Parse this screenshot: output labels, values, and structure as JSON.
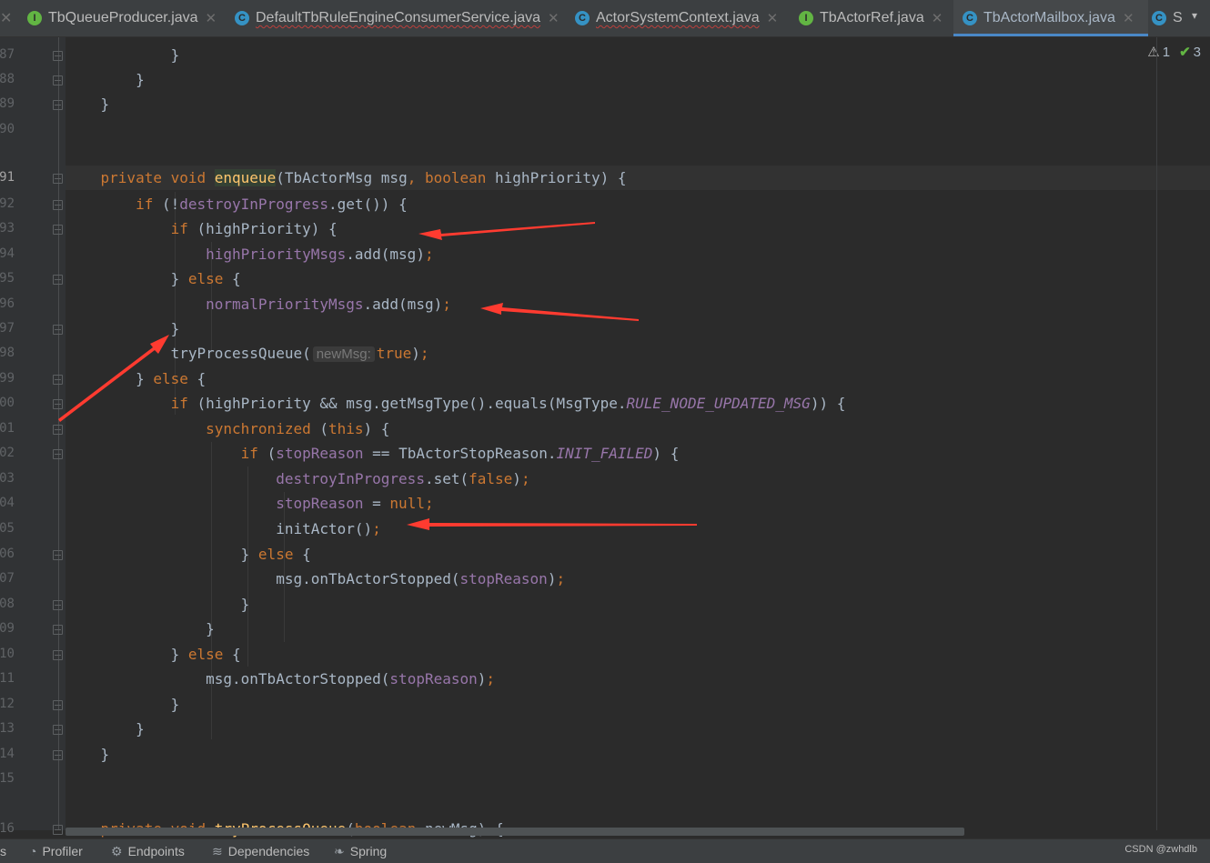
{
  "tabs": [
    {
      "label": "TbQueueProducer.java",
      "icon": "interface-icon",
      "letter": "I",
      "kind": "i"
    },
    {
      "label": "DefaultTbRuleEngineConsumerService.java",
      "icon": "class-icon",
      "letter": "C",
      "kind": "c"
    },
    {
      "label": "ActorSystemContext.java",
      "icon": "class-icon",
      "letter": "C",
      "kind": "c"
    },
    {
      "label": "TbActorRef.java",
      "icon": "interface-icon",
      "letter": "I",
      "kind": "i"
    },
    {
      "label": "TbActorMailbox.java",
      "icon": "class-icon",
      "letter": "C",
      "kind": "c",
      "active": true
    },
    {
      "label": "S",
      "icon": "class-icon",
      "letter": "C",
      "kind": "c"
    }
  ],
  "inspections": {
    "warnings": "1",
    "ok": "3"
  },
  "lines": [
    {
      "n": "87",
      "segs": [
        [
          "p",
          "            }"
        ]
      ]
    },
    {
      "n": "88",
      "segs": [
        [
          "p",
          "        }"
        ]
      ]
    },
    {
      "n": "89",
      "segs": [
        [
          "p",
          "    }"
        ]
      ]
    },
    {
      "n": "90",
      "segs": []
    },
    {
      "n": "91",
      "current": true,
      "segs": [
        [
          "k",
          "    private void "
        ],
        [
          "mh",
          "enqueue"
        ],
        [
          "p",
          "(TbActorMsg msg"
        ],
        [
          "k",
          ", boolean "
        ],
        [
          "p",
          "highPriority) {"
        ]
      ]
    },
    {
      "n": "92",
      "segs": [
        [
          "k",
          "        if "
        ],
        [
          "p",
          "(!"
        ],
        [
          "f",
          "destroyInProgress"
        ],
        [
          "p",
          ".get()) {"
        ]
      ]
    },
    {
      "n": "93",
      "segs": [
        [
          "k",
          "            if "
        ],
        [
          "p",
          "(highPriority) {"
        ]
      ]
    },
    {
      "n": "94",
      "segs": [
        [
          "f",
          "                highPriorityMsgs"
        ],
        [
          "p",
          ".add(msg)"
        ],
        [
          "k",
          ";"
        ]
      ]
    },
    {
      "n": "95",
      "segs": [
        [
          "p",
          "            } "
        ],
        [
          "k",
          "else "
        ],
        [
          "p",
          "{"
        ]
      ]
    },
    {
      "n": "96",
      "segs": [
        [
          "f",
          "                normalPriorityMsgs"
        ],
        [
          "p",
          ".add(msg)"
        ],
        [
          "k",
          ";"
        ]
      ]
    },
    {
      "n": "97",
      "segs": [
        [
          "p",
          "            }"
        ]
      ]
    },
    {
      "n": "98",
      "segs": [
        [
          "p",
          "            tryProcessQueue("
        ],
        [
          "h",
          "newMsg:"
        ],
        [
          "k",
          "true"
        ],
        [
          "p",
          ")"
        ],
        [
          "k",
          ";"
        ]
      ]
    },
    {
      "n": "99",
      "segs": [
        [
          "p",
          "        } "
        ],
        [
          "k",
          "else "
        ],
        [
          "p",
          "{"
        ]
      ]
    },
    {
      "n": "100",
      "segs": [
        [
          "k",
          "            if "
        ],
        [
          "p",
          "(highPriority && msg.getMsgType().equals(MsgType."
        ],
        [
          "fi",
          "RULE_NODE_UPDATED_MSG"
        ],
        [
          "p",
          ")) {"
        ]
      ]
    },
    {
      "n": "101",
      "segs": [
        [
          "k",
          "                synchronized "
        ],
        [
          "p",
          "("
        ],
        [
          "k",
          "this"
        ],
        [
          "p",
          ") {"
        ]
      ]
    },
    {
      "n": "102",
      "segs": [
        [
          "k",
          "                    if "
        ],
        [
          "p",
          "("
        ],
        [
          "f",
          "stopReason"
        ],
        [
          "p",
          " == TbActorStopReason."
        ],
        [
          "fi",
          "INIT_FAILED"
        ],
        [
          "p",
          ") {"
        ]
      ]
    },
    {
      "n": "103",
      "segs": [
        [
          "f",
          "                        destroyInProgress"
        ],
        [
          "p",
          ".set("
        ],
        [
          "k",
          "false"
        ],
        [
          "p",
          ")"
        ],
        [
          "k",
          ";"
        ]
      ]
    },
    {
      "n": "104",
      "segs": [
        [
          "f",
          "                        stopReason "
        ],
        [
          "p",
          "= "
        ],
        [
          "k",
          "null;"
        ]
      ]
    },
    {
      "n": "105",
      "segs": [
        [
          "p",
          "                        initActor()"
        ],
        [
          "k",
          ";"
        ]
      ]
    },
    {
      "n": "106",
      "segs": [
        [
          "p",
          "                    } "
        ],
        [
          "k",
          "else "
        ],
        [
          "p",
          "{"
        ]
      ]
    },
    {
      "n": "107",
      "segs": [
        [
          "p",
          "                        msg.onTbActorStopped("
        ],
        [
          "f",
          "stopReason"
        ],
        [
          "p",
          ")"
        ],
        [
          "k",
          ";"
        ]
      ]
    },
    {
      "n": "108",
      "segs": [
        [
          "p",
          "                    }"
        ]
      ]
    },
    {
      "n": "109",
      "segs": [
        [
          "p",
          "                }"
        ]
      ]
    },
    {
      "n": "110",
      "segs": [
        [
          "p",
          "            } "
        ],
        [
          "k",
          "else "
        ],
        [
          "p",
          "{"
        ]
      ]
    },
    {
      "n": "111",
      "segs": [
        [
          "p",
          "                msg.onTbActorStopped("
        ],
        [
          "f",
          "stopReason"
        ],
        [
          "p",
          ")"
        ],
        [
          "k",
          ";"
        ]
      ]
    },
    {
      "n": "112",
      "segs": [
        [
          "p",
          "            }"
        ]
      ]
    },
    {
      "n": "113",
      "segs": [
        [
          "p",
          "        }"
        ]
      ]
    },
    {
      "n": "114",
      "segs": [
        [
          "p",
          "    }"
        ]
      ]
    },
    {
      "n": "115",
      "segs": []
    },
    {
      "n": "116",
      "segs": [
        [
          "k",
          "    private void "
        ],
        [
          "m",
          "tryProcessQueue"
        ],
        [
          "p",
          "("
        ],
        [
          "k",
          "boolean "
        ],
        [
          "p",
          "newMsg) {"
        ]
      ]
    }
  ],
  "status": [
    {
      "label": "Profiler",
      "icon": "profiler-icon"
    },
    {
      "label": "Endpoints",
      "icon": "endpoints-icon"
    },
    {
      "label": "Dependencies",
      "icon": "dependencies-icon"
    },
    {
      "label": "Spring",
      "icon": "spring-icon"
    }
  ],
  "status_left_fragment": "s",
  "watermark": "CSDN @zwhdlb",
  "colors": {
    "background": "#2b2b2b",
    "keyword": "#cc7832",
    "field": "#9876aa",
    "method": "#ffc66d",
    "plain": "#a9b7c6",
    "arrow": "#ff3b30",
    "active_tab": "#4a88c7"
  }
}
